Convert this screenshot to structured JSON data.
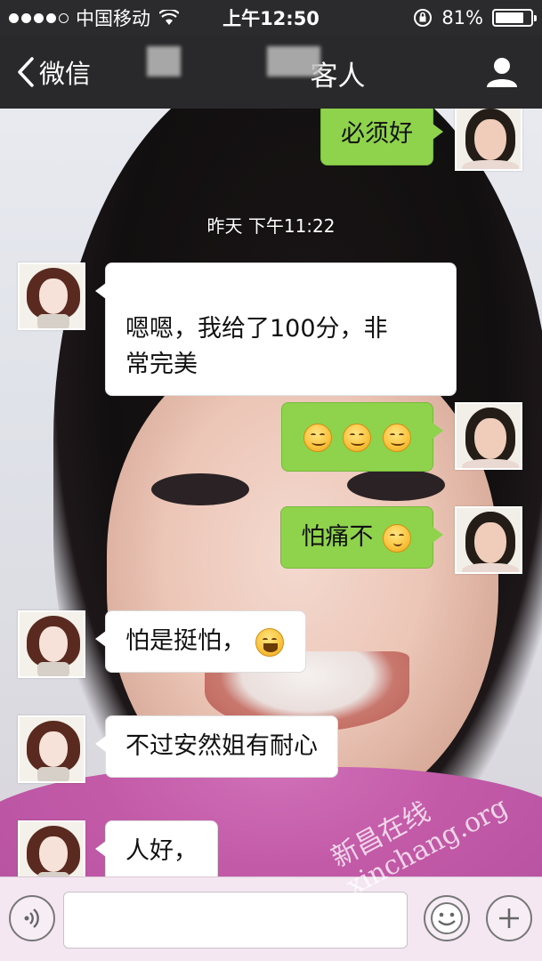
{
  "status_bar": {
    "carrier": "中国移动",
    "time": "上午12:50",
    "battery": "81%",
    "battery_level": 0.81,
    "signal_bars": 4
  },
  "nav": {
    "back_label": "微信",
    "title_visible": "客人"
  },
  "chat": {
    "timestamp": "昨天 下午11:22",
    "messages": [
      {
        "side": "right",
        "text": "必须好"
      },
      {
        "side": "left",
        "text": "嗯嗯，我给了100分，非\n常完美"
      },
      {
        "side": "right",
        "text": "",
        "emojis": [
          "smile-emoji",
          "smile-emoji",
          "smile-emoji"
        ]
      },
      {
        "side": "right",
        "text": "怕痛不",
        "emojis": [
          "thinking-emoji"
        ]
      },
      {
        "side": "left",
        "text": "怕是挺怕，",
        "emojis": [
          "laughing-crying-emoji"
        ]
      },
      {
        "side": "left",
        "text": "不过安然姐有耐心"
      },
      {
        "side": "left",
        "text": "人好，"
      }
    ]
  },
  "input_bar": {
    "placeholder": ""
  },
  "watermark": "新昌在线 xinchang.org",
  "colors": {
    "self_bubble": "#8fd34d",
    "other_bubble": "#ffffff",
    "nav_bg": "#29292b",
    "input_bar_bg": "#f4e7f1"
  }
}
